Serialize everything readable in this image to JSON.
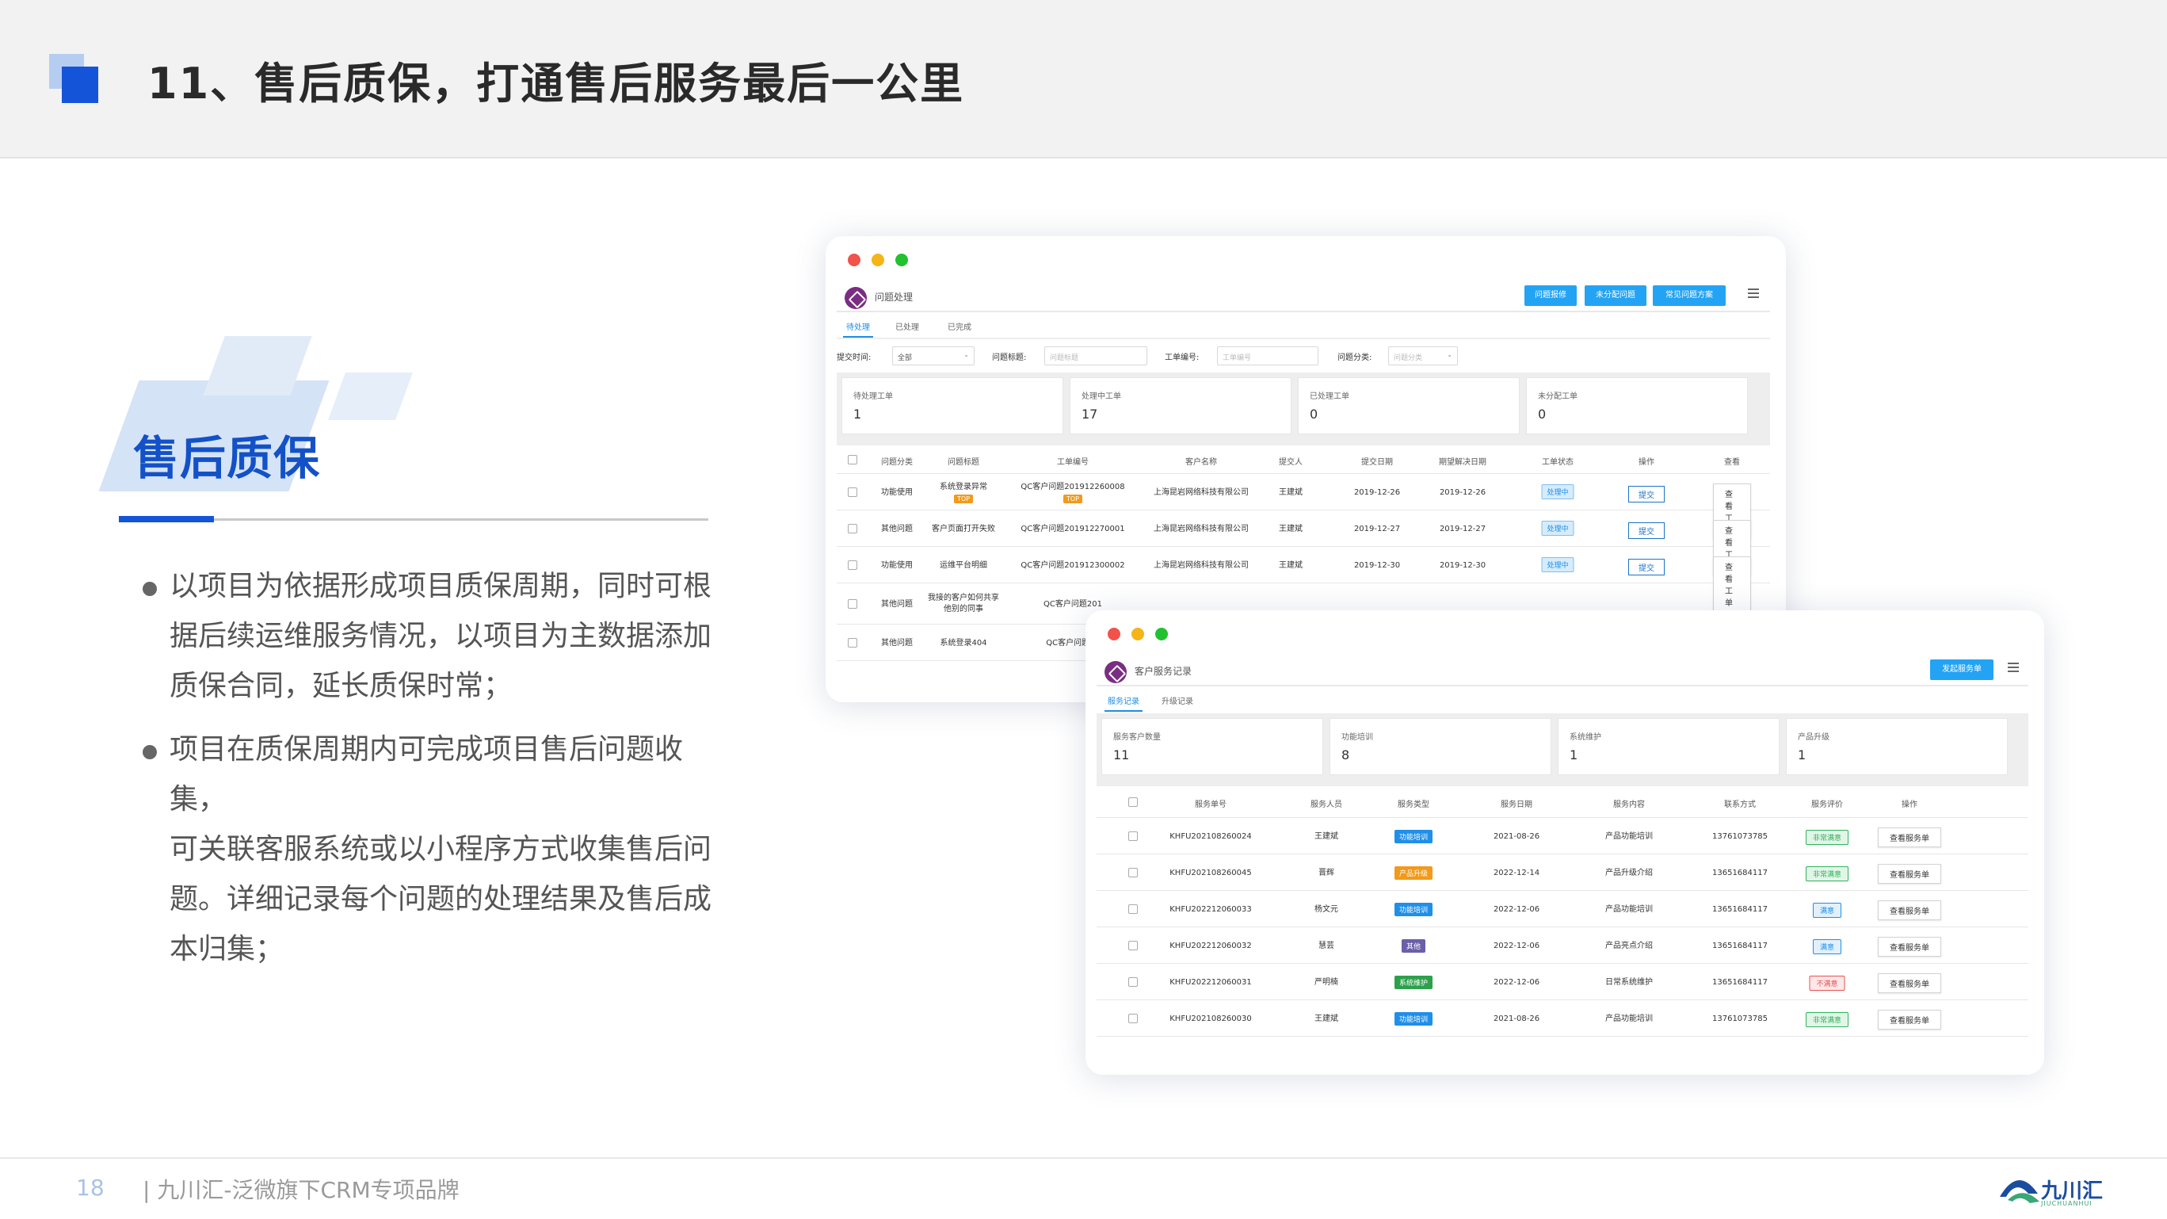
{
  "header": {
    "title": "11、售后质保，打通售后服务最后一公里"
  },
  "left": {
    "section_title": "售后质保",
    "bullets": [
      [
        "以项目为依据形成项目质保周期，同时可根",
        "据后续运维服务情况，以项目为主数据添加",
        "质保合同，延长质保时常；"
      ],
      [
        "项目在质保周期内可完成项目售后问题收集，",
        "可关联客服系统或以小程序方式收集售后问",
        "题。详细记录每个问题的处理结果及售后成",
        "本归集；"
      ]
    ]
  },
  "footer": {
    "page_number": "18",
    "brand": "| 九川汇-泛微旗下CRM专项品牌",
    "logo_text": "九川汇",
    "logo_sub": "JIUCHUANHUI"
  },
  "window1": {
    "app_title": "问题处理",
    "buttons": [
      "问题报修",
      "未分配问题",
      "常见问题方案"
    ],
    "tabs": [
      "待处理",
      "已处理",
      "已完成"
    ],
    "filters": {
      "submit_time_label": "提交时间:",
      "submit_time_value": "全部",
      "title_label": "问题标题:",
      "title_placeholder": "问题标题",
      "order_label": "工单编号:",
      "order_placeholder": "工单编号",
      "category_label": "问题分类:",
      "category_placeholder": "问题分类"
    },
    "stats": [
      {
        "label": "待处理工单",
        "value": "1"
      },
      {
        "label": "处理中工单",
        "value": "17"
      },
      {
        "label": "已处理工单",
        "value": "0"
      },
      {
        "label": "未分配工单",
        "value": "0"
      }
    ],
    "columns": [
      "问题分类",
      "问题标题",
      "工单编号",
      "客户名称",
      "提交人",
      "提交日期",
      "期望解决日期",
      "工单状态",
      "操作",
      "查看"
    ],
    "rows": [
      {
        "category": "功能使用",
        "title": "系统登录异常",
        "title_tag": "TOP",
        "order": "QC客户问题201912260008",
        "order_tag": "TOP",
        "customer": "上海昆岩网络科技有限公司",
        "submitter": "王建斌",
        "date": "2019-12-26",
        "expect": "2019-12-26",
        "status": "处理中",
        "op": "提交",
        "view": "查看工单"
      },
      {
        "category": "其他问题",
        "title": "客户页面打开失败",
        "order": "QC客户问题201912270001",
        "customer": "上海昆岩网络科技有限公司",
        "submitter": "王建斌",
        "date": "2019-12-27",
        "expect": "2019-12-27",
        "status": "处理中",
        "op": "提交",
        "view": "查看工单"
      },
      {
        "category": "功能使用",
        "title": "运维平台明细",
        "order": "QC客户问题201912300002",
        "customer": "上海昆岩网络科技有限公司",
        "submitter": "王建斌",
        "date": "2019-12-30",
        "expect": "2019-12-30",
        "status": "处理中",
        "op": "提交",
        "view": "查看工单"
      },
      {
        "category": "其他问题",
        "title": "我接的客户如何共享他别的同事",
        "order": "QC客户问题201"
      },
      {
        "category": "其他问题",
        "title": "系统登录404",
        "order": "QC客户问题20"
      }
    ]
  },
  "window2": {
    "app_title": "客户服务记录",
    "buttons": [
      "发起服务单"
    ],
    "tabs": [
      "服务记录",
      "升级记录"
    ],
    "stats": [
      {
        "label": "服务客户数量",
        "value": "11"
      },
      {
        "label": "功能培训",
        "value": "8"
      },
      {
        "label": "系统维护",
        "value": "1"
      },
      {
        "label": "产品升级",
        "value": "1"
      }
    ],
    "columns": [
      "服务单号",
      "服务人员",
      "服务类型",
      "服务日期",
      "服务内容",
      "联系方式",
      "服务评价",
      "操作"
    ],
    "rows": [
      {
        "no": "KHFU202108260024",
        "staff": "王建斌",
        "type": "功能培训",
        "type_color": "#1f8fe8",
        "date": "2021-08-26",
        "content": "产品功能培训",
        "phone": "13761073785",
        "rating": "非常满意",
        "rating_color": "#2fb35a",
        "op": "查看服务单"
      },
      {
        "no": "KHFU202108260045",
        "staff": "晋辉",
        "type": "产品升级",
        "type_color": "#f29a1b",
        "date": "2022-12-14",
        "content": "产品升级介绍",
        "phone": "13651684117",
        "rating": "非常满意",
        "rating_color": "#2fb35a",
        "op": "查看服务单"
      },
      {
        "no": "KHFU202212060033",
        "staff": "杨文元",
        "type": "功能培训",
        "type_color": "#1f8fe8",
        "date": "2022-12-06",
        "content": "产品功能培训",
        "phone": "13651684117",
        "rating": "满意",
        "rating_color": "#1f8fe8",
        "op": "查看服务单"
      },
      {
        "no": "KHFU202212060032",
        "staff": "慧芸",
        "type": "其他",
        "type_color": "#6a5fa8",
        "date": "2022-12-06",
        "content": "产品亮点介绍",
        "phone": "13651684117",
        "rating": "满意",
        "rating_color": "#1f8fe8",
        "op": "查看服务单"
      },
      {
        "no": "KHFU202212060031",
        "staff": "严明楠",
        "type": "系统维护",
        "type_color": "#2da04b",
        "date": "2022-12-06",
        "content": "日常系统维护",
        "phone": "13651684117",
        "rating": "不满意",
        "rating_color": "#e85050",
        "op": "查看服务单"
      },
      {
        "no": "KHFU202108260030",
        "staff": "王建斌",
        "type": "功能培训",
        "type_color": "#1f8fe8",
        "date": "2021-08-26",
        "content": "产品功能培训",
        "phone": "13761073785",
        "rating": "非常满意",
        "rating_color": "#2fb35a",
        "op": "查看服务单"
      }
    ]
  }
}
